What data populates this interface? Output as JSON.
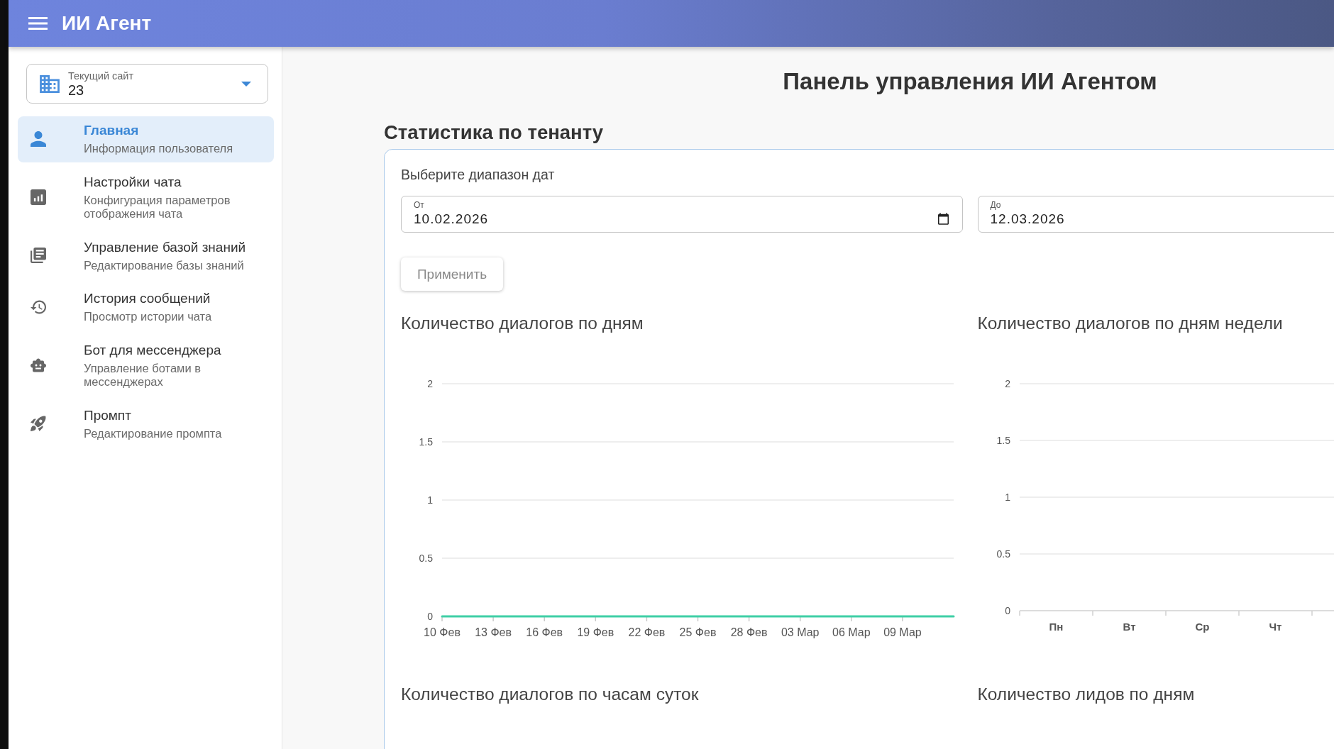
{
  "header": {
    "title": "ИИ Агент"
  },
  "sidebar": {
    "site_select": {
      "label": "Текущий сайт",
      "value": "23"
    },
    "items": [
      {
        "title": "Главная",
        "subtitle": "Информация пользователя",
        "selected": true
      },
      {
        "title": "Настройки чата",
        "subtitle": "Конфигурация параметров отображения чата",
        "selected": false
      },
      {
        "title": "Управление базой знаний",
        "subtitle": "Редактирование базы знаний",
        "selected": false
      },
      {
        "title": "История сообщений",
        "subtitle": "Просмотр истории чата",
        "selected": false
      },
      {
        "title": "Бот для мессенджера",
        "subtitle": "Управление ботами в мессенджерах",
        "selected": false
      },
      {
        "title": "Промпт",
        "subtitle": "Редактирование промпта",
        "selected": false
      }
    ]
  },
  "main": {
    "title": "Панель управления ИИ Агентом",
    "section_title": "Статистика по тенанту",
    "date_range": {
      "label": "Выберите диапазон дат",
      "from": {
        "label": "От",
        "value": "10.02.2026"
      },
      "to": {
        "label": "До",
        "value": "12.03.2026"
      }
    },
    "apply_button": "Применить",
    "charts": [
      {
        "title": "Количество диалогов по дням",
        "chart_data": {
          "type": "line",
          "grid": true,
          "categories": [
            "10 Фев",
            null,
            null,
            "13 Фев",
            null,
            null,
            "16 Фев",
            null,
            null,
            "19 Фев",
            null,
            null,
            "22 Фев",
            null,
            null,
            "25 Фев",
            null,
            null,
            "28 Фев",
            null,
            null,
            "03 Мар",
            null,
            null,
            "06 Мар",
            null,
            null,
            "09 Мар",
            null,
            null,
            null
          ],
          "ylim": [
            0,
            2
          ],
          "yticks": [
            0,
            0.5,
            1,
            1.5,
            2
          ],
          "series": [
            {
              "color": "#3fcfa6",
              "values": [
                0,
                0,
                0,
                0,
                0,
                0,
                0,
                0,
                0,
                0,
                0,
                0,
                0,
                0,
                0,
                0,
                0,
                0,
                0,
                0,
                0,
                0,
                0,
                0,
                0,
                0,
                0,
                0,
                0,
                0,
                0
              ]
            }
          ]
        }
      },
      {
        "title": "Количество диалогов по дням недели",
        "chart_data": {
          "type": "bar",
          "grid": true,
          "categories": [
            "Пн",
            "Вт",
            "Ср",
            "Чт"
          ],
          "values": [
            0,
            0,
            0,
            0
          ],
          "ylim": [
            0,
            2
          ],
          "yticks": [
            0,
            0.5,
            1,
            1.5,
            2
          ]
        }
      },
      {
        "title": "Количество диалогов по часам суток"
      },
      {
        "title": "Количество лидов по дням"
      }
    ]
  }
}
